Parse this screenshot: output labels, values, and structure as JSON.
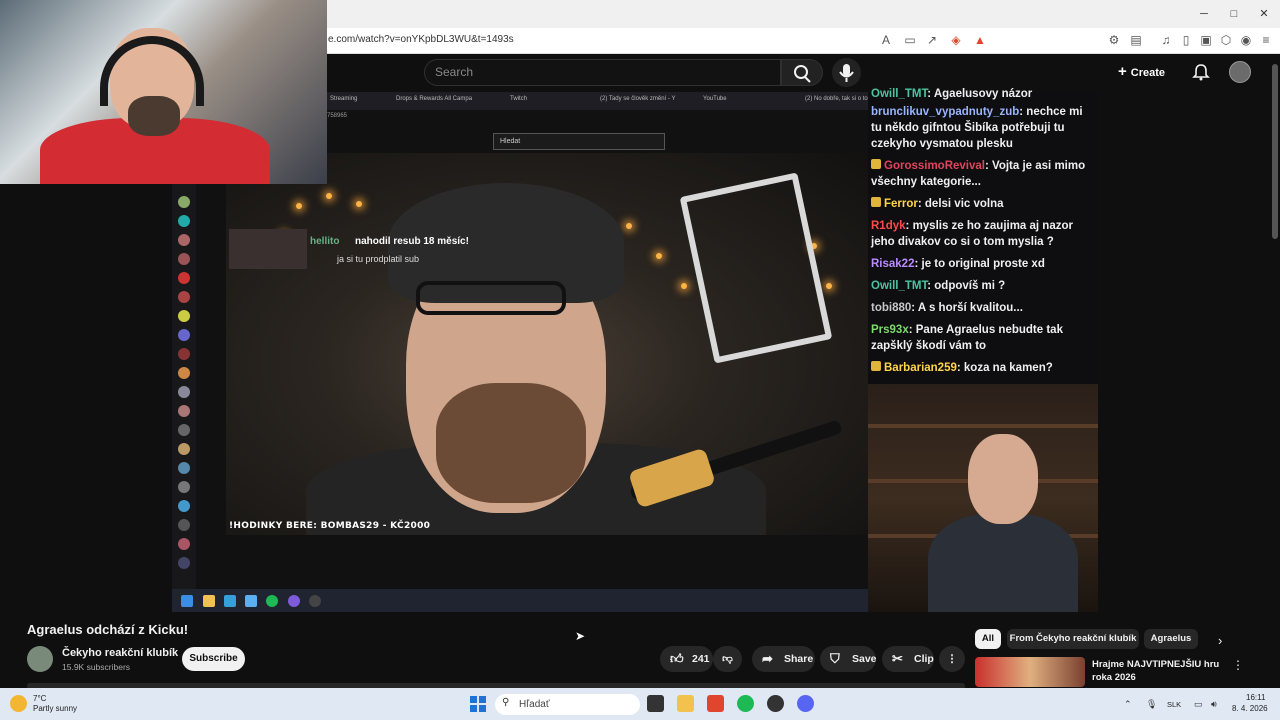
{
  "browser": {
    "url": "e.com/watch?v=onYKpbDL3WU&t=1493s",
    "window_controls": [
      "─",
      "□",
      "✕"
    ]
  },
  "header": {
    "search_placeholder": "Search",
    "create_label": "Create"
  },
  "stream": {
    "inner_tabs": [
      "Streaming",
      "Drops & Rewards All Campa",
      "Twitch",
      "(2) Tady se člověk změní - Y",
      "YouTube",
      "(2) No dobře, tak si o tom"
    ],
    "inner_url": "758965",
    "inner_search_placeholder": "Hledat",
    "sub_alert": {
      "name": "hellito",
      "text": "nahodil resub 18 měsíc!",
      "sub": "ja si tu prodplatil sub"
    },
    "overlay_text": "!HODINKY BERE: BOMBAS29 - KČ2000"
  },
  "chat": [
    {
      "name": "Owill_TMT",
      "color": "#4fc3a1",
      "text": "Agaelusovy názor",
      "badge": false
    },
    {
      "name": "brunclikuv_vypadnuty_zub",
      "color": "#9ab4ff",
      "text": "nechce mi tu někdo gifntou Šibíka potřebuji tu czekyho vysmatou plesku",
      "badge": false
    },
    {
      "name": "GorossimoRevival",
      "color": "#e0445c",
      "text": "Vojta je asi mimo všechny kategorie...",
      "badge": true
    },
    {
      "name": "Ferror",
      "color": "#ffd54a",
      "text": "delsi vic volna",
      "badge": true
    },
    {
      "name": "R1dyk",
      "color": "#ff4a4a",
      "text": "myslis ze ho zaujima aj nazor jeho divakov co si o tom myslia ?",
      "badge": false
    },
    {
      "name": "Risak22",
      "color": "#b98bff",
      "text": "je to original proste xd",
      "badge": false
    },
    {
      "name": "Owill_TMT",
      "color": "#4fc3a1",
      "text": "odpovíš mi ?",
      "badge": false
    },
    {
      "name": "tobi880",
      "color": "#c8c8c8",
      "text": "A s horší kvalitou...",
      "badge": false
    },
    {
      "name": "Prs93x",
      "color": "#7cdb6a",
      "text": "Pane Agraelus nebudte tak zapšklý škodí vám to",
      "badge": false
    },
    {
      "name": "Barbarian259",
      "color": "#ffd54a",
      "text": "koza na kamen?",
      "badge": true
    }
  ],
  "video": {
    "title": "Agraelus odchází z Kicku!",
    "channel": "Čekyho reakční klubík",
    "subscribers": "15.9K subscribers",
    "subscribe_label": "Subscribe",
    "likes": "241",
    "share_label": "Share",
    "save_label": "Save",
    "clip_label": "Clip",
    "more_label": "⋮"
  },
  "chips": {
    "all": "All",
    "from": "From Čekyho reakční klubík",
    "agraelus": "Agraelus"
  },
  "recommendation": {
    "title": "Hrajme NAJVTIPNEJŠIU hru roka 2026"
  },
  "taskbar": {
    "temp": "7°C",
    "weather": "Partly sunny",
    "search_placeholder": "Hľadať",
    "lang": "SLK",
    "time": "16:11",
    "date": "8. 4. 2026"
  },
  "colors": {
    "accent_red": "#ff0000",
    "youtube_bg": "#0f0f0f",
    "pill_bg": "#272727"
  }
}
